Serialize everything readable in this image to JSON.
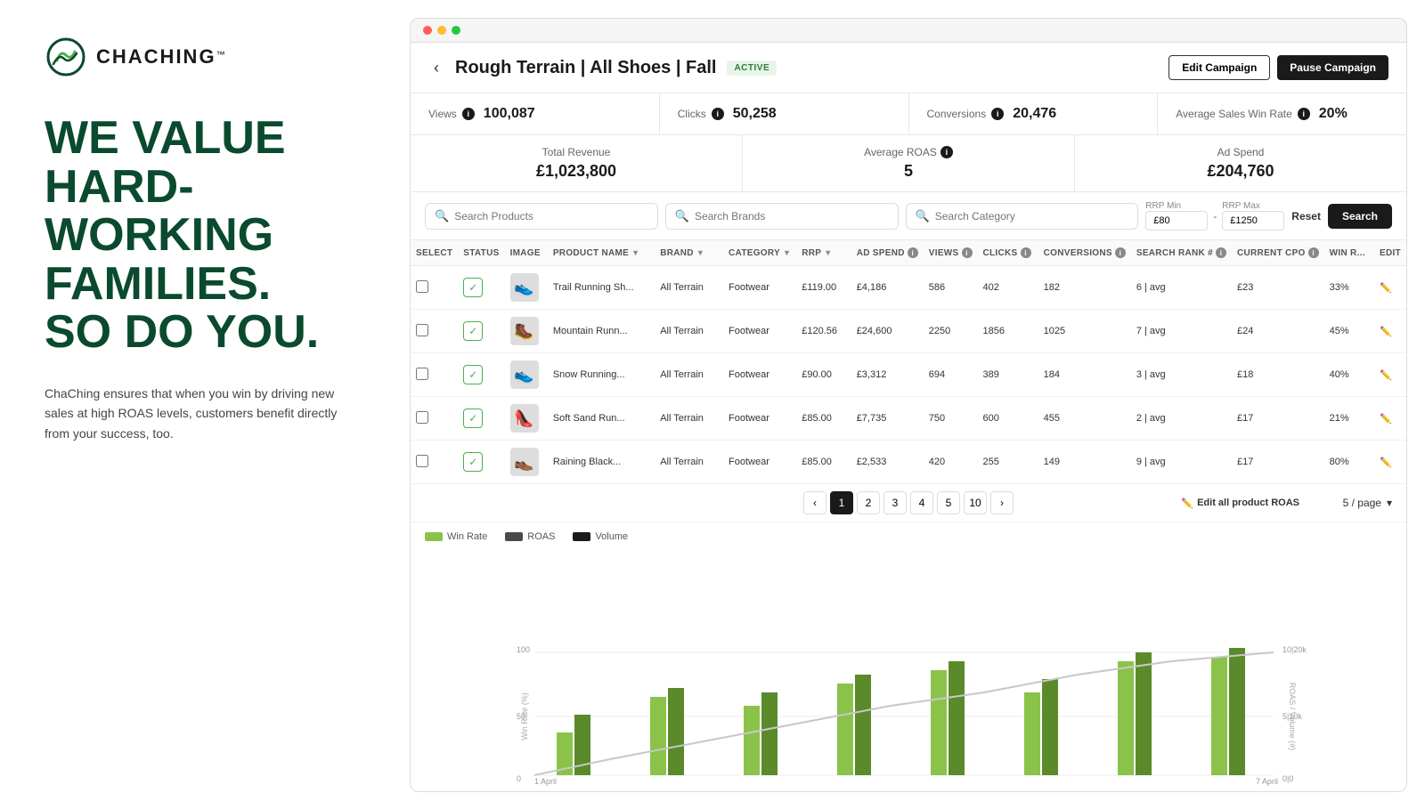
{
  "brand": {
    "logo_text": "CHACHING",
    "logo_tm": "™"
  },
  "hero": {
    "line1": "WE VALUE",
    "line2": "HARD-",
    "line3": "WORKING",
    "line4": "FAMILIES.",
    "line5": "SO DO YOU.",
    "subtext": "ChaChing ensures that when you win by driving new sales at high ROAS levels, customers benefit directly from your success, too."
  },
  "header": {
    "campaign_title": "Rough Terrain | All Shoes | Fall",
    "status": "ACTIVE",
    "edit_btn": "Edit Campaign",
    "pause_btn": "Pause Campaign",
    "back": "‹"
  },
  "metrics": [
    {
      "label": "Views",
      "value": "100,087"
    },
    {
      "label": "Clicks",
      "value": "50,258"
    },
    {
      "label": "Conversions",
      "value": "20,476"
    },
    {
      "label": "Average Sales Win Rate",
      "value": "20%"
    }
  ],
  "revenue": [
    {
      "label": "Total Revenue",
      "value": "£1,023,800"
    },
    {
      "label": "Average ROAS",
      "value": "5"
    },
    {
      "label": "Ad Spend",
      "value": "£204,760"
    }
  ],
  "search": {
    "products_placeholder": "Search Products",
    "brands_placeholder": "Search Brands",
    "category_placeholder": "Search Category",
    "rrp_min_label": "RRP Min",
    "rrp_min_value": "£80",
    "rrp_max_label": "RRP Max",
    "rrp_max_value": "£1250",
    "reset_btn": "Reset",
    "search_btn": "Search"
  },
  "table": {
    "columns": [
      "SELECT",
      "STATUS",
      "IMAGE",
      "PRODUCT NAME",
      "BRAND",
      "CATEGORY",
      "RRP",
      "AD SPEND",
      "VIEWS",
      "CLICKS",
      "CONVERSIONS",
      "SEARCH RANK #",
      "CURRENT CPO",
      "WIN R...",
      "EDIT"
    ],
    "rows": [
      {
        "product": "Trail Running Sh...",
        "brand": "All Terrain",
        "category": "Footwear",
        "rrp": "£119.00",
        "ad_spend": "£4,186",
        "views": "586",
        "clicks": "402",
        "conversions": "182",
        "rank": "6 | avg",
        "cpo": "£23",
        "win": "33%",
        "emoji": "👟"
      },
      {
        "product": "Mountain Runn...",
        "brand": "All Terrain",
        "category": "Footwear",
        "rrp": "£120.56",
        "ad_spend": "£24,600",
        "views": "2250",
        "clicks": "1856",
        "conversions": "1025",
        "rank": "7 | avg",
        "cpo": "£24",
        "win": "45%",
        "emoji": "🥾"
      },
      {
        "product": "Snow Running...",
        "brand": "All Terrain",
        "category": "Footwear",
        "rrp": "£90.00",
        "ad_spend": "£3,312",
        "views": "694",
        "clicks": "389",
        "conversions": "184",
        "rank": "3 | avg",
        "cpo": "£18",
        "win": "40%",
        "emoji": "👟"
      },
      {
        "product": "Soft Sand Run...",
        "brand": "All Terrain",
        "category": "Footwear",
        "rrp": "£85.00",
        "ad_spend": "£7,735",
        "views": "750",
        "clicks": "600",
        "conversions": "455",
        "rank": "2 | avg",
        "cpo": "£17",
        "win": "21%",
        "emoji": "👠"
      },
      {
        "product": "Raining Black...",
        "brand": "All Terrain",
        "category": "Footwear",
        "rrp": "£85.00",
        "ad_spend": "£2,533",
        "views": "420",
        "clicks": "255",
        "conversions": "149",
        "rank": "9 | avg",
        "cpo": "£17",
        "win": "80%",
        "emoji": "👞"
      }
    ]
  },
  "pagination": {
    "pages": [
      "1",
      "2",
      "3",
      "4",
      "5"
    ],
    "more": "10",
    "per_page": "5 / page",
    "edit_all": "Edit all product ROAS"
  },
  "chart": {
    "legend": {
      "win_rate": "Win Rate",
      "roas": "ROAS",
      "volume": "Volume"
    },
    "y_left": "Win Rate (%)",
    "y_right": "ROAS / Volume (#)",
    "x_left": "1 April",
    "x_right": "7 April",
    "y_max_left": "100",
    "y_mid_left": "50",
    "y_min_left": "0",
    "y_max_right": "10 | 20k",
    "y_mid_right": "5 | 10k",
    "y_min_right": "0 | 0"
  }
}
